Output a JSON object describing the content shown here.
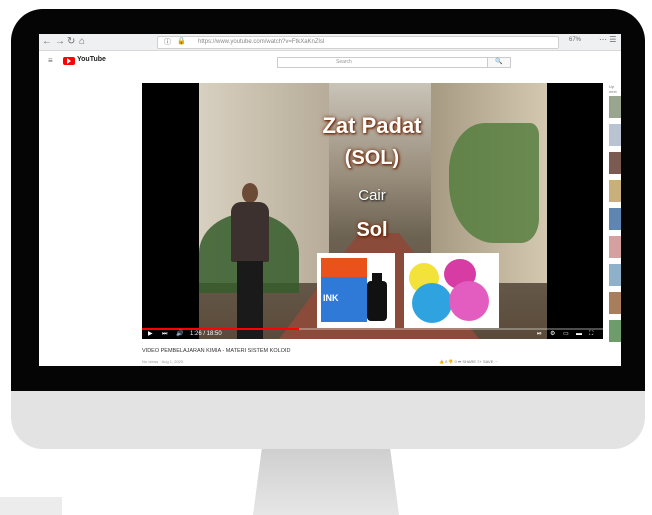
{
  "browser": {
    "url": "https://www.youtube.com/watch?v=FtkXaKnZlsI",
    "zoom": "67%",
    "nav_back": "←",
    "nav_forward": "→",
    "nav_reload": "↻",
    "nav_home": "⌂",
    "menu": "⋯ ☰"
  },
  "youtube": {
    "logo_text": "YouTube",
    "search_placeholder": "Search",
    "search_icon": "🔍"
  },
  "video": {
    "overlay_title": "Zat Padat",
    "overlay_subtitle": "(SOL)",
    "overlay_line3": "Cair",
    "overlay_line4": "Sol",
    "ink_label": "INK",
    "time": "1:26 / 18:50",
    "progress": 0.34,
    "title": "VIDEO PEMBELAJARAN KIMIA - MATERI SISTEM KOLOID",
    "meta": "No views · Aug 1, 2020",
    "actions": "👍 0   👎 0   ➦ SHARE   ≡+ SAVE   ⋯"
  },
  "sidebar": {
    "up_next": "Up next"
  },
  "colors": {
    "monitor_bezel": "#050505",
    "monitor_chin": "#e3e3e3",
    "progress_red": "#ff0000"
  }
}
